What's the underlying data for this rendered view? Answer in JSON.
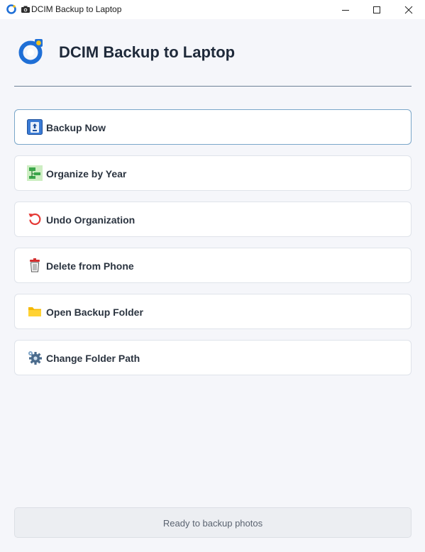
{
  "window": {
    "title": "DCIM Backup to Laptop",
    "controls": [
      "minimize-icon",
      "maximize-icon",
      "close-icon"
    ]
  },
  "header": {
    "title": "DCIM Backup to Laptop",
    "logo_icon": "camera-lens-logo-icon",
    "accent": "#1f6fd6"
  },
  "actions": [
    {
      "label": "Backup Now",
      "icon": "backup-icon",
      "active": true
    },
    {
      "label": "Organize by Year",
      "icon": "organize-icon",
      "active": false
    },
    {
      "label": "Undo Organization",
      "icon": "undo-icon",
      "active": false
    },
    {
      "label": "Delete from Phone",
      "icon": "trash-icon",
      "active": false
    },
    {
      "label": "Open Backup Folder",
      "icon": "folder-icon",
      "active": false
    },
    {
      "label": "Change Folder Path",
      "icon": "gear-icon",
      "active": false
    }
  ],
  "status": {
    "text": "Ready to backup photos"
  }
}
